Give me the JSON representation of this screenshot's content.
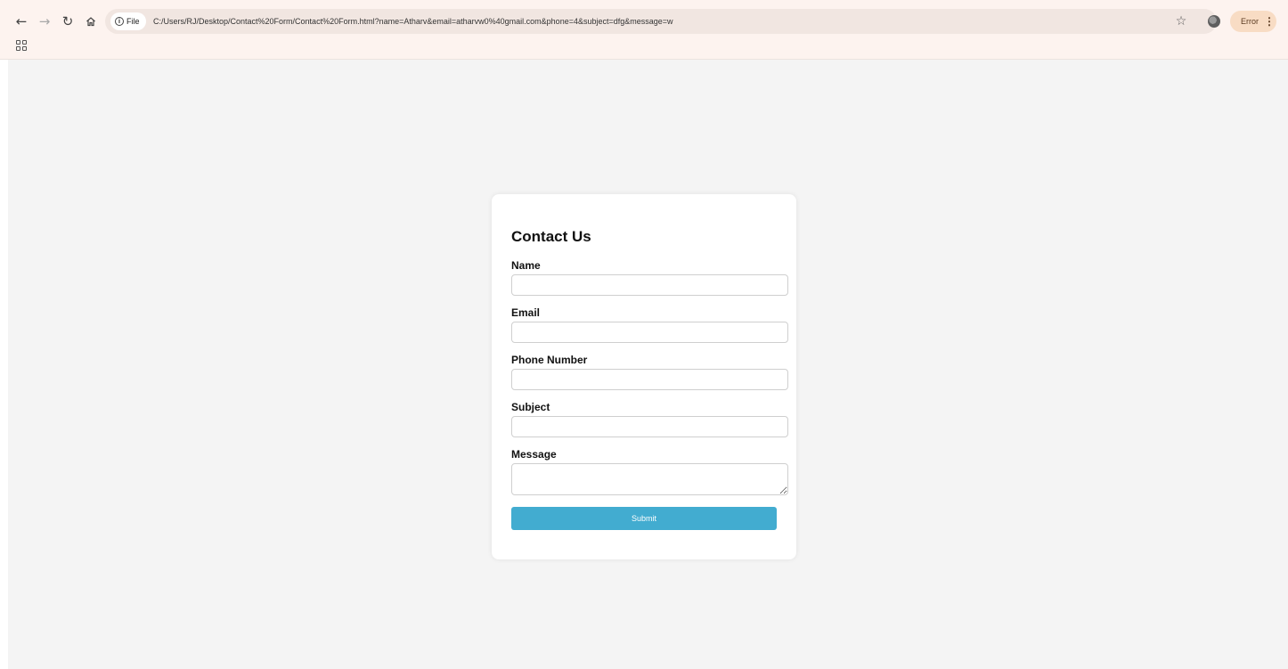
{
  "browser": {
    "back_icon": "arrow-left-icon",
    "forward_icon": "arrow-right-icon",
    "reload_icon": "reload-icon",
    "home_icon": "home-icon",
    "site_chip_label": "File",
    "url": "C:/Users/RJ/Desktop/Contact%20Form/Contact%20Form.html?name=Atharv&email=atharvw0%40gmail.com&phone=4&subject=dfg&message=w",
    "error_label": "Error",
    "menu_icon": "⋮"
  },
  "form": {
    "title": "Contact Us",
    "fields": {
      "name_label": "Name",
      "email_label": "Email",
      "phone_label": "Phone Number",
      "subject_label": "Subject",
      "message_label": "Message"
    },
    "values": {
      "name": "",
      "email": "",
      "phone": "",
      "subject": "",
      "message": ""
    },
    "submit_label": "Submit"
  },
  "colors": {
    "chrome_bg": "#fdf3ef",
    "page_bg": "#f4f4f4",
    "submit_button": "#42acd0",
    "error_pill": "#f8dcc4"
  }
}
